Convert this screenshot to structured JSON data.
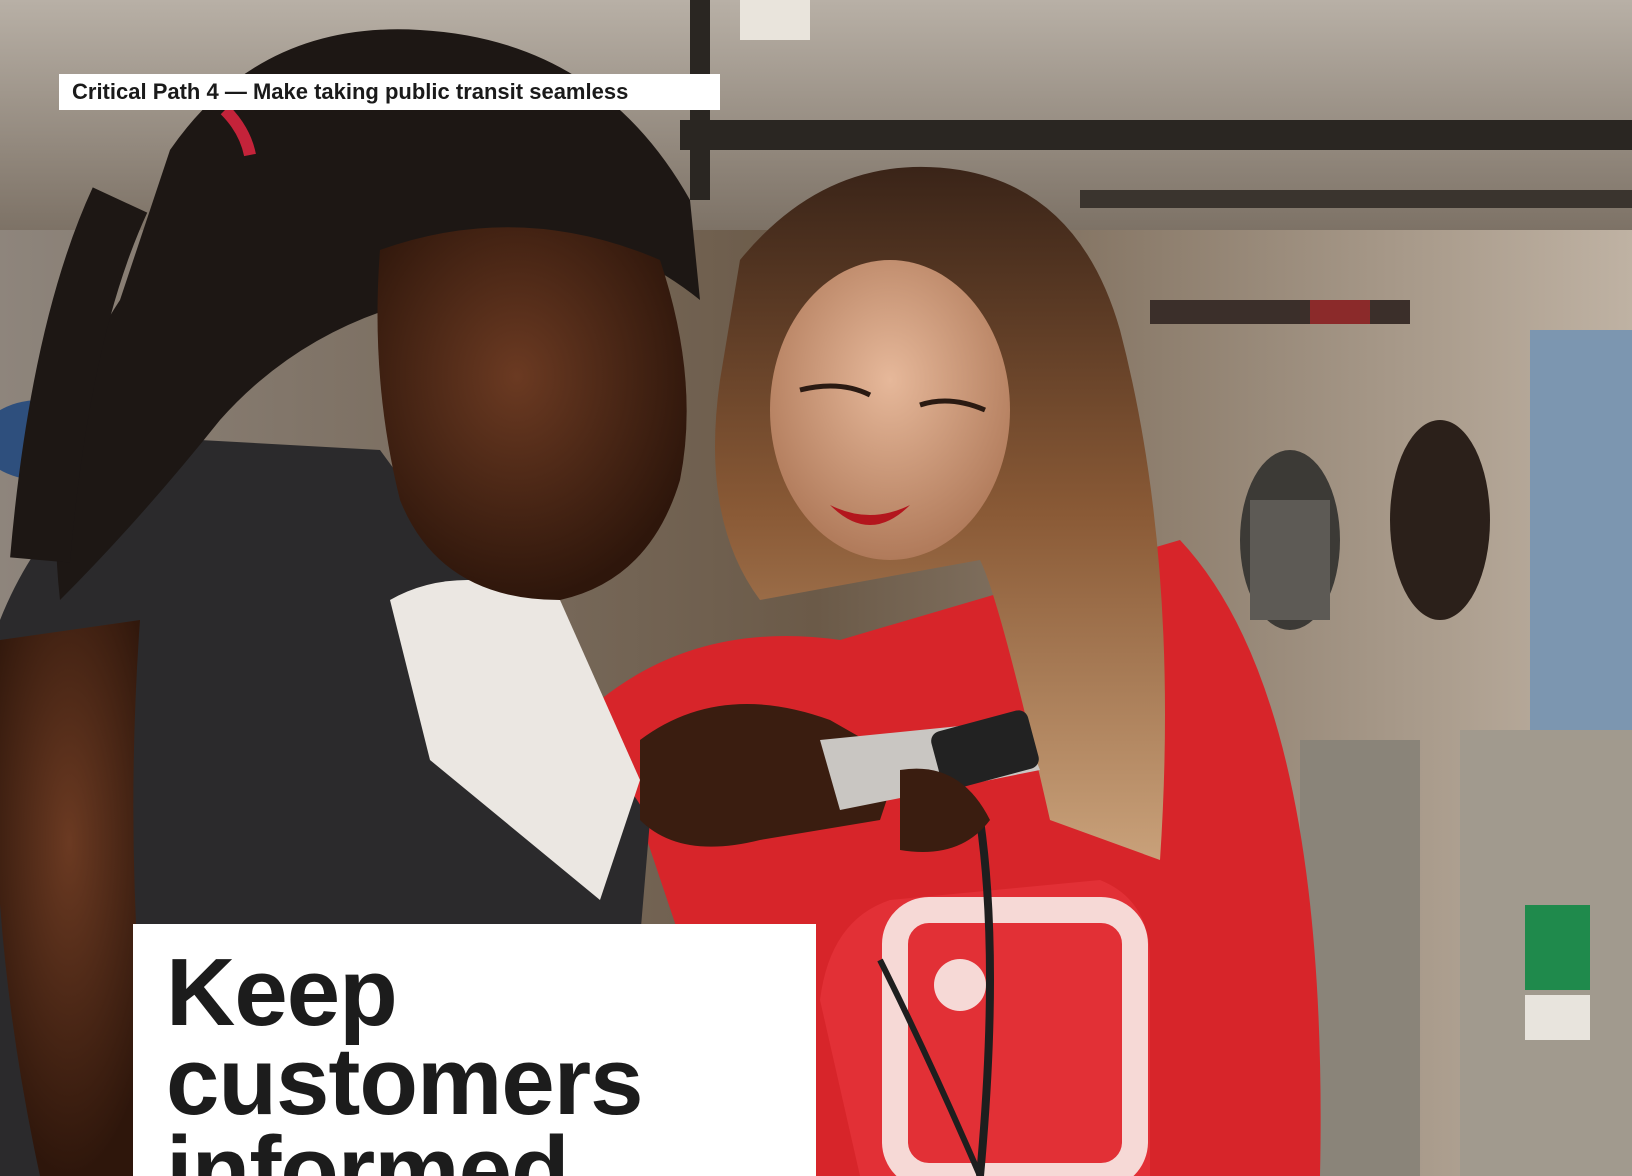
{
  "header": {
    "section_label": "Critical Path 4 — Make taking public transit seamless"
  },
  "headline": {
    "text": "Keep customers informed"
  },
  "photo": {
    "description_icon": "photo-two-women-with-smartphone-in-transit-station"
  }
}
